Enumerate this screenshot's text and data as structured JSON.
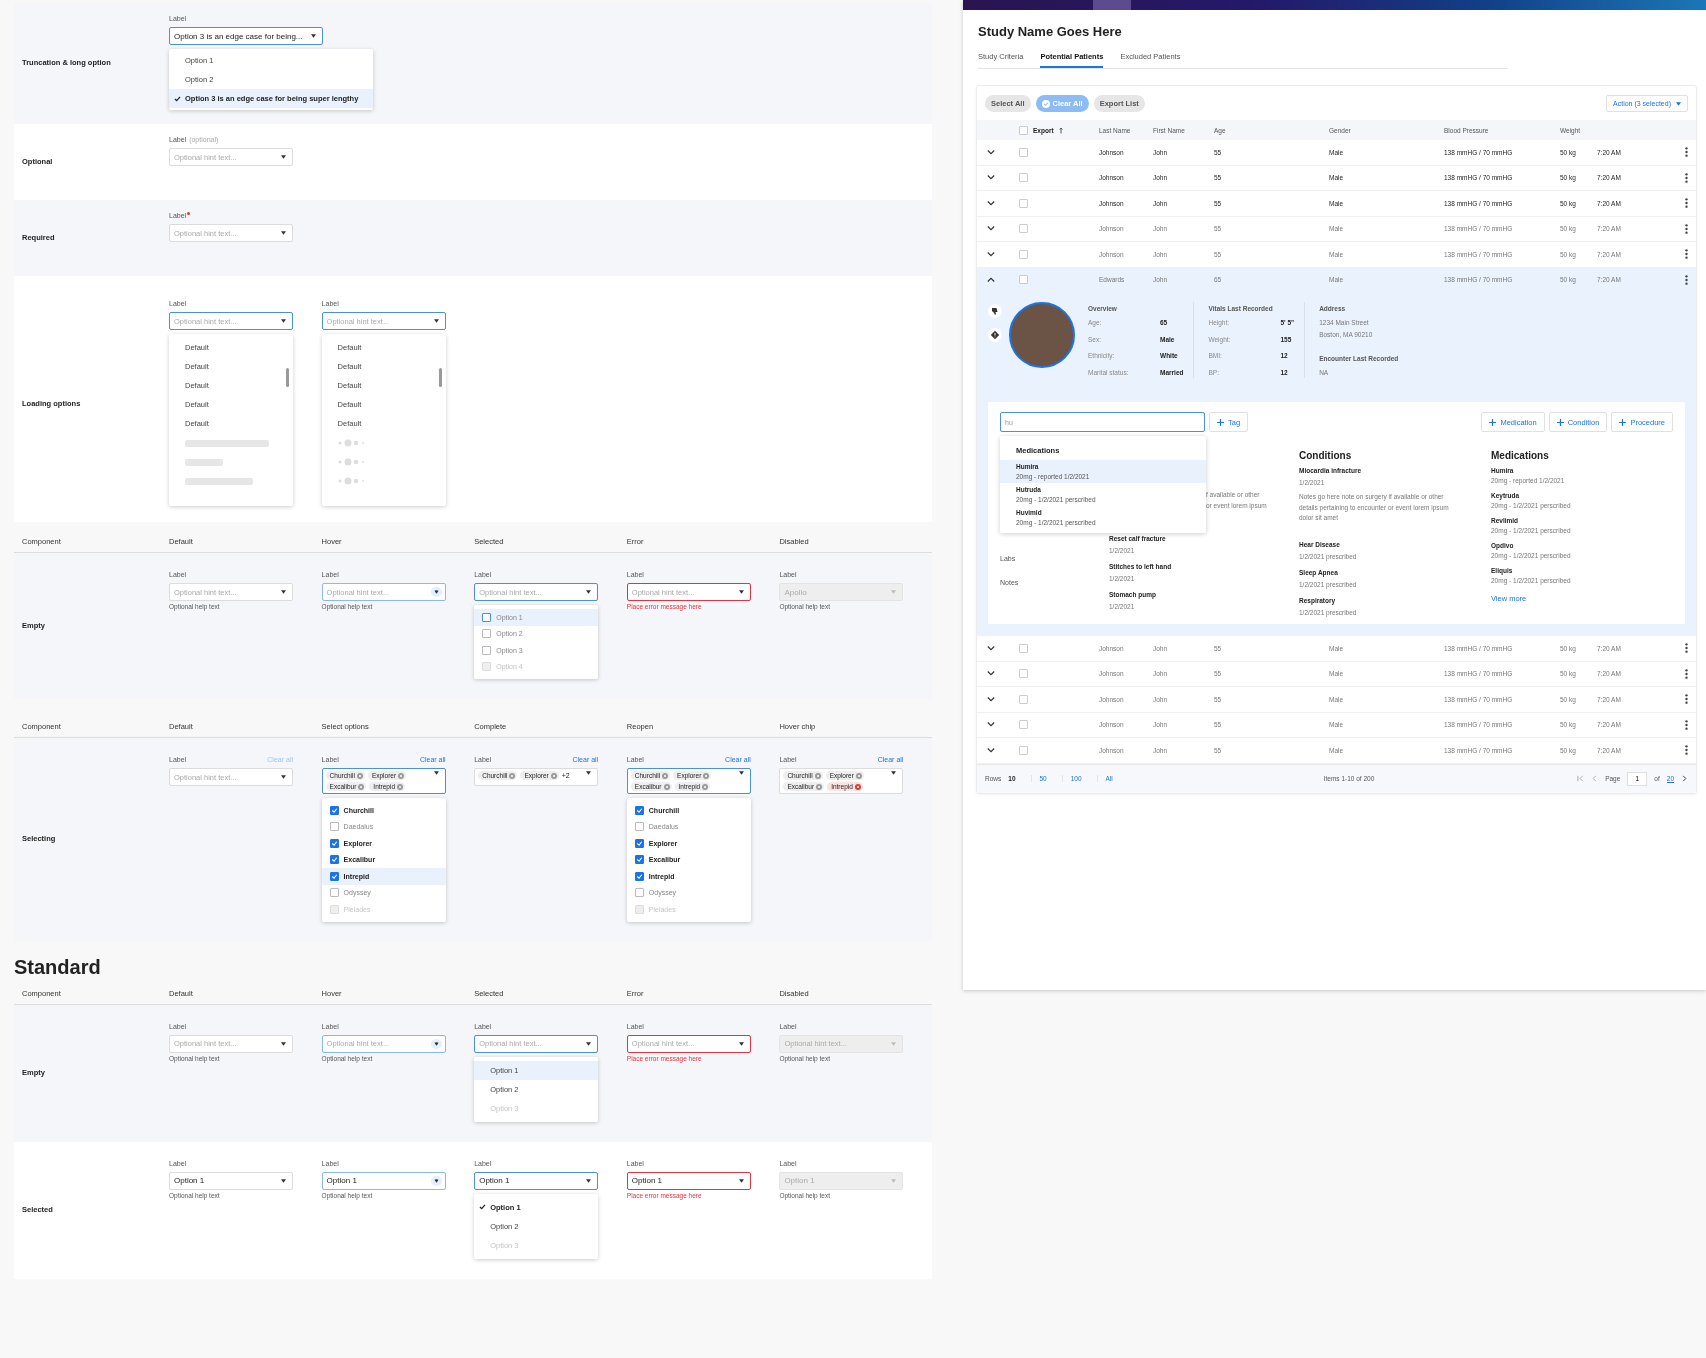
{
  "groups": [
    {
      "rows": [
        {
          "title": "Truncation & long option",
          "fields": [
            {
              "label": "Label",
              "kind": "focus",
              "value": "Option 3 is an edge case for being...",
              "menu": {
                "kind": "list",
                "items": [
                  {
                    "text": "Option 1",
                    "selected": false,
                    "hovered": false,
                    "disabled": false
                  },
                  {
                    "text": "Option 2",
                    "selected": false,
                    "hovered": false,
                    "disabled": false
                  },
                  {
                    "text": "Option 3 is an edge case for being super lengthy",
                    "selected": true,
                    "hovered": true,
                    "disabled": false
                  }
                ]
              }
            }
          ]
        },
        {
          "title": "Optional",
          "fields": [
            {
              "label": "Label",
              "label_note": "(optional)",
              "kind": "default",
              "placeholder": "Optional hint text..."
            }
          ]
        },
        {
          "title": "Required",
          "fields": [
            {
              "label": "Label",
              "required": true,
              "kind": "default",
              "placeholder": "Optional hint text..."
            }
          ]
        },
        {
          "title": "Loading options",
          "fields": [
            {
              "label": "Label",
              "kind": "focus",
              "placeholder": "Optional hint text...",
              "menu": {
                "kind": "loading-bars",
                "items": [
                  {
                    "text": "Default"
                  },
                  {
                    "text": "Default"
                  },
                  {
                    "text": "Default"
                  },
                  {
                    "text": "Default"
                  },
                  {
                    "text": "Default"
                  }
                ]
              }
            },
            {
              "label": "Label",
              "kind": "focus",
              "placeholder": "Optional hint text...",
              "menu": {
                "kind": "loading-dots",
                "items": [
                  {
                    "text": "Default"
                  },
                  {
                    "text": "Default"
                  },
                  {
                    "text": "Default"
                  },
                  {
                    "text": "Default"
                  },
                  {
                    "text": "Default"
                  }
                ]
              }
            }
          ]
        }
      ]
    },
    {
      "columns": [
        "Component",
        "Default",
        "Hover",
        "Selected",
        "Error",
        "Disabled"
      ],
      "rows": [
        {
          "title": "Empty",
          "fields": [
            {
              "label": "Label",
              "kind": "default",
              "placeholder": "Optional hint text...",
              "help": "Optional help text"
            },
            {
              "label": "Label",
              "kind": "hover",
              "placeholder": "Optional hint text...",
              "help": "Optional help text"
            },
            {
              "label": "Label",
              "kind": "focus",
              "placeholder": "Optional hint text...",
              "menu": {
                "kind": "checkbox",
                "items": [
                  {
                    "text": "Option 1",
                    "checked": false,
                    "hovered": true,
                    "disabled": false
                  },
                  {
                    "text": "Option 2",
                    "checked": false,
                    "hovered": false,
                    "disabled": false
                  },
                  {
                    "text": "Option 3",
                    "checked": false,
                    "hovered": false,
                    "disabled": false
                  },
                  {
                    "text": "Option 4",
                    "checked": false,
                    "hovered": false,
                    "disabled": true
                  }
                ]
              }
            },
            {
              "label": "Label",
              "kind": "error",
              "placeholder": "Optional hint text...",
              "error": "Place error message here"
            },
            {
              "label": "Label",
              "kind": "disabled",
              "value": "Apollo",
              "help": "Optional help text"
            }
          ]
        }
      ]
    },
    {
      "columns": [
        "Component",
        "Default",
        "Select options",
        "Complete",
        "Reopen",
        "Hover chip"
      ],
      "rows": [
        {
          "title": "Selecting",
          "fields": [
            {
              "label": "Label",
              "clear_all": {
                "text": "Clear all",
                "disabled": true
              },
              "kind": "default",
              "placeholder": "Optional hint text..."
            },
            {
              "label": "Label",
              "clear_all": {
                "text": "Clear all",
                "disabled": false
              },
              "kind": "focus",
              "chips": [
                {
                  "text": "Churchill",
                  "hovered": false
                },
                {
                  "text": "Explorer",
                  "hovered": false
                },
                {
                  "text": "Excalibur",
                  "hovered": false
                },
                {
                  "text": "Intrepid",
                  "hovered": false
                }
              ],
              "menu": {
                "kind": "checkbox",
                "items": [
                  {
                    "text": "Churchill",
                    "checked": true,
                    "hovered": false,
                    "disabled": false
                  },
                  {
                    "text": "Daedalus",
                    "checked": false,
                    "hovered": false,
                    "disabled": false
                  },
                  {
                    "text": "Explorer",
                    "checked": true,
                    "hovered": false,
                    "disabled": false
                  },
                  {
                    "text": "Excalibur",
                    "checked": true,
                    "hovered": false,
                    "disabled": false
                  },
                  {
                    "text": "Intrepid",
                    "checked": true,
                    "hovered": true,
                    "disabled": false
                  },
                  {
                    "text": "Odyssey",
                    "checked": false,
                    "hovered": false,
                    "disabled": false
                  },
                  {
                    "text": "Pleiades",
                    "checked": false,
                    "hovered": false,
                    "disabled": true
                  }
                ]
              }
            },
            {
              "label": "Label",
              "clear_all": {
                "text": "Clear all",
                "disabled": false
              },
              "kind": "default",
              "chips": [
                {
                  "text": "Churchill",
                  "hovered": false
                },
                {
                  "text": "Explorer",
                  "hovered": false
                }
              ],
              "more": "+2"
            },
            {
              "label": "Label",
              "clear_all": {
                "text": "Clear all",
                "disabled": false
              },
              "kind": "focus",
              "chips": [
                {
                  "text": "Churchill",
                  "hovered": false
                },
                {
                  "text": "Explorer",
                  "hovered": false
                },
                {
                  "text": "Excalibur",
                  "hovered": false
                },
                {
                  "text": "Intrepid",
                  "hovered": false
                }
              ],
              "menu": {
                "kind": "checkbox",
                "items": [
                  {
                    "text": "Churchill",
                    "checked": true,
                    "hovered": false,
                    "disabled": false
                  },
                  {
                    "text": "Daedalus",
                    "checked": false,
                    "hovered": false,
                    "disabled": false
                  },
                  {
                    "text": "Explorer",
                    "checked": true,
                    "hovered": false,
                    "disabled": false
                  },
                  {
                    "text": "Excalibur",
                    "checked": true,
                    "hovered": false,
                    "disabled": false
                  },
                  {
                    "text": "Intrepid",
                    "checked": true,
                    "hovered": false,
                    "disabled": false
                  },
                  {
                    "text": "Odyssey",
                    "checked": false,
                    "hovered": false,
                    "disabled": false
                  },
                  {
                    "text": "Pleiades",
                    "checked": false,
                    "hovered": false,
                    "disabled": true
                  }
                ]
              }
            },
            {
              "label": "Label",
              "clear_all": {
                "text": "Clear all",
                "disabled": false
              },
              "kind": "default",
              "chips": [
                {
                  "text": "Churchill",
                  "hovered": false
                },
                {
                  "text": "Explorer",
                  "hovered": false
                },
                {
                  "text": "Excalibur",
                  "hovered": false
                },
                {
                  "text": "Intrepid",
                  "hovered": true
                }
              ]
            }
          ]
        }
      ]
    },
    {
      "heading": "Standard",
      "columns": [
        "Component",
        "Default",
        "Hover",
        "Selected",
        "Error",
        "Disabled"
      ],
      "rows": [
        {
          "title": "Empty",
          "fields": [
            {
              "label": "Label",
              "kind": "default",
              "placeholder": "Optional hint text...",
              "help": "Optional help text"
            },
            {
              "label": "Label",
              "kind": "hover",
              "placeholder": "Optional hint text...",
              "help": "Optional help text"
            },
            {
              "label": "Label",
              "kind": "focus",
              "placeholder": "Optional hint text...",
              "menu": {
                "kind": "list",
                "items": [
                  {
                    "text": "Option 1",
                    "selected": false,
                    "hovered": true,
                    "disabled": false
                  },
                  {
                    "text": "Option 2",
                    "selected": false,
                    "hovered": false,
                    "disabled": false
                  },
                  {
                    "text": "Option 3",
                    "selected": false,
                    "hovered": false,
                    "disabled": true
                  }
                ]
              }
            },
            {
              "label": "Label",
              "kind": "error",
              "placeholder": "Optional hint text...",
              "error": "Place error message here"
            },
            {
              "label": "Label",
              "kind": "disabled",
              "placeholder": "Optional hint text...",
              "help": "Optional help text"
            }
          ]
        },
        {
          "title": "Selected",
          "fields": [
            {
              "label": "Label",
              "kind": "default",
              "value": "Option 1",
              "help": "Optional help text"
            },
            {
              "label": "Label",
              "kind": "hover",
              "value": "Option 1",
              "help": "Optional help text"
            },
            {
              "label": "Label",
              "kind": "focus",
              "value": "Option 1",
              "menu": {
                "kind": "list",
                "items": [
                  {
                    "text": "Option 1",
                    "selected": true,
                    "hovered": false,
                    "disabled": false
                  },
                  {
                    "text": "Option 2",
                    "selected": false,
                    "hovered": false,
                    "disabled": false
                  },
                  {
                    "text": "Option 3",
                    "selected": false,
                    "hovered": false,
                    "disabled": true
                  }
                ]
              }
            },
            {
              "label": "Label",
              "kind": "error",
              "value": "Option 1",
              "error": "Place error message here"
            },
            {
              "label": "Label",
              "kind": "disabled",
              "value": "Option 1",
              "help": "Optional help text"
            }
          ]
        }
      ]
    }
  ],
  "study": {
    "title": "Study Name Goes Here",
    "tabs": [
      {
        "label": "Study Criteria",
        "selected": false
      },
      {
        "label": "Potential Patients",
        "selected": true
      },
      {
        "label": "Excluded Patients",
        "selected": false
      }
    ],
    "toolbar": {
      "buttons": [
        {
          "label": "Select All",
          "selected": false
        },
        {
          "label": "Clear All",
          "selected": true
        },
        {
          "label": "Export List",
          "selected": false
        }
      ],
      "action": "Action (3 selected)"
    },
    "table": {
      "export_header": "Export",
      "header_checked": false,
      "columns": [
        "Last Name",
        "First Name",
        "Age",
        "Gender",
        "Blood Pressure",
        "Weight"
      ],
      "rows": [
        {
          "expanded": false,
          "checked": false,
          "highlighted": true,
          "cells": [
            "Johnson",
            "John",
            "55",
            "Male",
            "138 mmHG / 70 mmHG",
            "50 kg",
            "7:20 AM"
          ]
        },
        {
          "expanded": false,
          "checked": false,
          "highlighted": true,
          "cells": [
            "Johnson",
            "John",
            "55",
            "Male",
            "138 mmHG / 70 mmHG",
            "50 kg",
            "7:20 AM"
          ]
        },
        {
          "expanded": false,
          "checked": false,
          "highlighted": true,
          "cells": [
            "Johnson",
            "John",
            "55",
            "Male",
            "138 mmHG / 70 mmHG",
            "50 kg",
            "7:20 AM"
          ]
        },
        {
          "expanded": false,
          "checked": false,
          "highlighted": false,
          "cells": [
            "Johnson",
            "John",
            "55",
            "Male",
            "138 mmHG / 70 mmHG",
            "50 kg",
            "7:20 AM"
          ]
        },
        {
          "expanded": false,
          "checked": false,
          "highlighted": false,
          "cells": [
            "Johnson",
            "John",
            "55",
            "Male",
            "138 mmHG / 70 mmHG",
            "50 kg",
            "7:20 AM"
          ]
        },
        {
          "expanded": true,
          "checked": false,
          "highlighted": false,
          "cells": [
            "Edwards",
            "John",
            "65",
            "Male",
            "138 mmHG / 70 mmHG",
            "50 kg",
            "7:20 AM"
          ]
        },
        {
          "expanded": false,
          "checked": false,
          "highlighted": false,
          "cells": [
            "Johnson",
            "John",
            "55",
            "Male",
            "138 mmHG / 70 mmHG",
            "50 kg",
            "7:20 AM"
          ]
        },
        {
          "expanded": false,
          "checked": false,
          "highlighted": false,
          "cells": [
            "Johnson",
            "John",
            "55",
            "Male",
            "138 mmHG / 70 mmHG",
            "50 kg",
            "7:20 AM"
          ]
        },
        {
          "expanded": false,
          "checked": false,
          "highlighted": false,
          "cells": [
            "Johnson",
            "John",
            "55",
            "Male",
            "138 mmHG / 70 mmHG",
            "50 kg",
            "7:20 AM"
          ]
        },
        {
          "expanded": false,
          "checked": false,
          "highlighted": false,
          "cells": [
            "Johnson",
            "John",
            "55",
            "Male",
            "138 mmHG / 70 mmHG",
            "50 kg",
            "7:20 AM"
          ]
        },
        {
          "expanded": false,
          "checked": false,
          "highlighted": false,
          "cells": [
            "Johnson",
            "John",
            "55",
            "Male",
            "138 mmHG / 70 mmHG",
            "50 kg",
            "7:20 AM"
          ]
        }
      ]
    },
    "detail": {
      "overview": {
        "heading": "Overview",
        "items": [
          {
            "label": "Age:",
            "value": "65"
          },
          {
            "label": "Sex:",
            "value": "Male"
          },
          {
            "label": "Ethnicity:",
            "value": "White"
          },
          {
            "label": "Marital status:",
            "value": "Married"
          }
        ]
      },
      "vitals": {
        "heading": "Vitals Last Recorded",
        "items": [
          {
            "label": "Height:",
            "value": "5' 5\""
          },
          {
            "label": "Weight:",
            "value": "155"
          },
          {
            "label": "BMI:",
            "value": "12"
          },
          {
            "label": "BP:",
            "value": "12"
          }
        ]
      },
      "address": {
        "heading": "Address",
        "lines": [
          "1234 Main Street",
          "Boston, MA 90210"
        ]
      },
      "encounter": {
        "heading": "Encounter Last Recorded",
        "value": "NA"
      },
      "search": {
        "value": "hu"
      },
      "tag_button": "Tag",
      "add_buttons": [
        "Medication",
        "Condition",
        "Procedure"
      ],
      "suggestions": {
        "heading": "Medications",
        "items": [
          {
            "name": "Humira",
            "detail": "20mg - reported 1/2/2021",
            "hovered": true
          },
          {
            "name": "Hutruda",
            "detail": "20mg - 1/2/2021 perscribed",
            "hovered": false
          },
          {
            "name": "Huvimid",
            "detail": "20mg - 1/2/2021 perscribed",
            "hovered": false
          }
        ]
      },
      "nav": [
        "Labs",
        "Notes"
      ],
      "history": {
        "fragments": [
          "f available or other",
          "or event lorem ipsum"
        ],
        "items": [
          {
            "title": "Reset calf fracture",
            "date": "1/2/2021"
          },
          {
            "title": "Stitches to left hand",
            "date": "1/2/2021"
          },
          {
            "title": "Stomach pump",
            "date": "1/2/2021"
          }
        ]
      },
      "conditions": {
        "heading": "Conditions",
        "items": [
          {
            "title": "Miocardia infracture",
            "date": "1/2/2021",
            "note": "Notes go here note on surgery if available or other details pertaining to encounter or event lorem ipsum dolor sit amet"
          },
          {
            "title": "Hear Disease",
            "date": "1/2/2021 prescribed"
          },
          {
            "title": "Sleep Apnea",
            "date": "1/2/2021 prescribed"
          },
          {
            "title": "Respiratory",
            "date": "1/2/2021 prescribed"
          }
        ]
      },
      "medications": {
        "heading": "Medications",
        "items": [
          {
            "name": "Humira",
            "detail": "20mg - reported 1/2/2021"
          },
          {
            "name": "Keytruda",
            "detail": "20mg - 1/2/2021 perscribed"
          },
          {
            "name": "Revlimid",
            "detail": "20mg - 1/2/2021 perscribed"
          },
          {
            "name": "Opdivo",
            "detail": "20mg - 1/2/2021 perscribed"
          },
          {
            "name": "Eliquis",
            "detail": "20mg - 1/2/2021 perscribed"
          }
        ],
        "link": "View more"
      }
    },
    "footer": {
      "rows_label": "Rows",
      "row_options": [
        {
          "text": "10",
          "selected": true
        },
        {
          "text": "50",
          "selected": false
        },
        {
          "text": "100",
          "selected": false
        },
        {
          "text": "All",
          "selected": false
        }
      ],
      "items": "Items 1-10 of 200",
      "page_label": "Page",
      "page": "1",
      "of": "of",
      "pages": "20"
    }
  }
}
